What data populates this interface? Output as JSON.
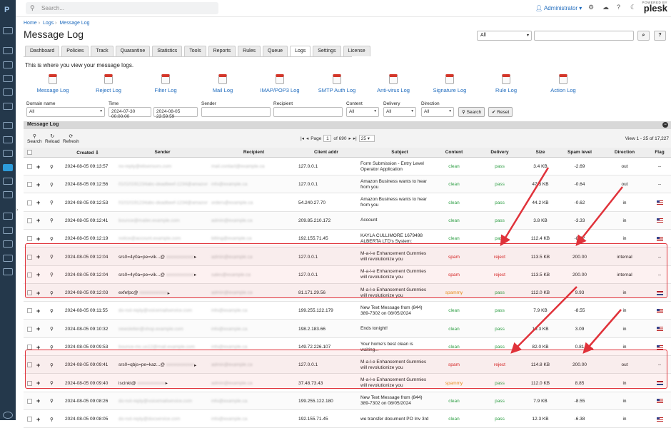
{
  "brand": {
    "logo": "P",
    "powered_by": "POWERED BY",
    "name": "plesk"
  },
  "search": {
    "placeholder": "Search..."
  },
  "user": {
    "name": "Administrator"
  },
  "breadcrumb": {
    "home": "Home",
    "logs": "Logs",
    "message_log": "Message Log"
  },
  "page": {
    "title": "Message Log",
    "intro": "This is where you view your message logs."
  },
  "top_filter": {
    "selected": "All",
    "search_btn": "⌕",
    "help_btn": "?"
  },
  "tabs": [
    "Dashboard",
    "Policies",
    "Track",
    "Quarantine",
    "Statistics",
    "Tools",
    "Reports",
    "Rules",
    "Queue",
    "Logs",
    "Settings",
    "License"
  ],
  "active_tab": "Logs",
  "log_links": [
    "Message Log",
    "Reject Log",
    "Filter Log",
    "Mail Log",
    "IMAP/POP3 Log",
    "SMTP Auth Log",
    "Anti-virus Log",
    "Signature Log",
    "Rule Log",
    "Action Log"
  ],
  "filters": {
    "domain_label": "Domain name",
    "domain_value": "All",
    "time_label": "Time",
    "time_from": "2024-07-30 00:00:00",
    "time_to": "2024-08-05 23:59:59",
    "sender_label": "Sender",
    "recipient_label": "Recipient",
    "content_label": "Content",
    "content_value": "All",
    "delivery_label": "Delivery",
    "delivery_value": "All",
    "direction_label": "Direction",
    "direction_value": "All",
    "search_btn": "Search",
    "reset_btn": "Reset"
  },
  "panel": {
    "title": "Message Log",
    "tool_search": "Search",
    "tool_reload": "Reload",
    "tool_refresh": "Refresh",
    "page_label": "Page",
    "page_value": "1",
    "page_total": "of 690",
    "per_page": "25",
    "view": "View 1 - 25 of 17,227"
  },
  "columns": [
    "Created",
    "Sender",
    "Recipient",
    "Client addr",
    "Subject",
    "Content",
    "Delivery",
    "Size",
    "Spam level",
    "Direction",
    "Flag"
  ],
  "created_sort": "⇩",
  "rows": [
    {
      "created": "2024-08-05 09:13:57",
      "sender": "no-reply@ebsensors.com",
      "recipient": "mail.contact@example.ca",
      "client": "127.0.0.1",
      "subject": "Form Submission - Entry Level Operator Application",
      "content": "clean",
      "delivery": "pass",
      "size": "3.4 KB",
      "spam": "-2.69",
      "dir": "out",
      "flag": "--"
    },
    {
      "created": "2024-08-05 09:12:56",
      "sender": "01010191234abc-deadbeef-1234@amazonses.com",
      "recipient": "info@example.ca",
      "client": "127.0.0.1",
      "subject": "Amazon Business wants to hear from you",
      "content": "clean",
      "delivery": "pass",
      "size": "47.3 KB",
      "spam": "-0.64",
      "dir": "out",
      "flag": "--"
    },
    {
      "created": "2024-08-05 09:12:53",
      "sender": "01010191234abc-deadbeef-1234@amazonses.com",
      "recipient": "orders@example.ca",
      "client": "54.240.27.70",
      "subject": "Amazon Business wants to hear from you",
      "content": "clean",
      "delivery": "pass",
      "size": "44.2 KB",
      "spam": "-0.62",
      "dir": "in",
      "flag": "us"
    },
    {
      "created": "2024-08-05 09:12:41",
      "sender": "bounce@mailer.example.com",
      "recipient": "admin@example.ca",
      "client": "209.85.210.172",
      "subject": "Account",
      "content": "clean",
      "delivery": "pass",
      "size": "3.8 KB",
      "spam": "-3.33",
      "dir": "in",
      "flag": "us"
    },
    {
      "created": "2024-08-05 09:12:19",
      "sender": "notice@account.example.com",
      "recipient": "billing@example.ca",
      "client": "192.155.71.45",
      "subject": "KAYLA CULLIMORE 1679498 ALBERTA LTD's System:",
      "content": "clean",
      "delivery": "pass",
      "size": "112.4 KB",
      "spam": "-8.22",
      "dir": "in",
      "flag": "us"
    },
    {
      "created": "2024-08-05 09:12:04",
      "sender": "srs0=4y0a=pe=vik...@",
      "recipient": "admin@example.ca",
      "client": "127.0.0.1",
      "subject": "M-a-l-e Enhancement Gummies will revolutionize you",
      "content": "spam",
      "delivery": "reject",
      "size": "113.5 KB",
      "spam": "200.00",
      "dir": "internal",
      "flag": "--"
    },
    {
      "created": "2024-08-05 09:12:04",
      "sender": "srs0=4y0a=pe=vik...@",
      "recipient": "sales@example.ca",
      "client": "127.0.0.1",
      "subject": "M-a-l-e Enhancement Gummies will revolutionize you",
      "content": "spam",
      "delivery": "reject",
      "size": "113.5 KB",
      "spam": "200.00",
      "dir": "internal",
      "flag": "--"
    },
    {
      "created": "2024-08-05 09:12:03",
      "sender": "exfefpc@",
      "recipient": "admin@example.ca",
      "client": "81.171.29.56",
      "subject": "M-a-l-e Enhancement Gummies will revolutionize you",
      "content": "spammy",
      "delivery": "pass",
      "size": "112.0 KB",
      "spam": "9.93",
      "dir": "in",
      "flag": "nl"
    },
    {
      "created": "2024-08-05 09:11:55",
      "sender": "do-not-reply@voicemailservice.com",
      "recipient": "info@example.ca",
      "client": "199.255.122.179",
      "subject": "New Text Message from (844) 389-7302 on 08/05/2024",
      "content": "clean",
      "delivery": "pass",
      "size": "7.9 KB",
      "spam": "-8.55",
      "dir": "in",
      "flag": "us"
    },
    {
      "created": "2024-08-05 09:10:32",
      "sender": "newsletter@shop.example.com",
      "recipient": "info@example.ca",
      "client": "198.2.183.66",
      "subject": "Ends tonight!",
      "content": "clean",
      "delivery": "pass",
      "size": "19.3 KB",
      "spam": "3.09",
      "dir": "in",
      "flag": "us"
    },
    {
      "created": "2024-08-05 09:09:53",
      "sender": "bounce-mc.us12@mail.example.com",
      "recipient": "info@example.ca",
      "client": "149.72.226.107",
      "subject": "Your home's best clean is waiting...",
      "content": "clean",
      "delivery": "pass",
      "size": "82.0 KB",
      "spam": "0.81",
      "dir": "in",
      "flag": "us"
    },
    {
      "created": "2024-08-05 09:09:41",
      "sender": "srs0=qbjs=pe=kaz...@",
      "recipient": "admin@example.ca",
      "client": "127.0.0.1",
      "subject": "M-a-l-e Enhancement Gummies will revolutionize you",
      "content": "spam",
      "delivery": "reject",
      "size": "114.8 KB",
      "spam": "200.00",
      "dir": "out",
      "flag": "--"
    },
    {
      "created": "2024-08-05 09:09:40",
      "sender": "iscinkt@",
      "recipient": "admin@example.ca",
      "client": "37.48.73.43",
      "subject": "M-a-l-e Enhancement Gummies will revolutionize you",
      "content": "spammy",
      "delivery": "pass",
      "size": "112.0 KB",
      "spam": "8.85",
      "dir": "in",
      "flag": "nl"
    },
    {
      "created": "2024-08-05 09:08:26",
      "sender": "do-not-reply@voicemailservice.com",
      "recipient": "info@example.ca",
      "client": "199.255.122.180",
      "subject": "New Text Message from (844) 389-7302 on 08/05/2024",
      "content": "clean",
      "delivery": "pass",
      "size": "7.9 KB",
      "spam": "-8.55",
      "dir": "in",
      "flag": "us"
    },
    {
      "created": "2024-08-05 09:08:05",
      "sender": "do-not-reply@docservice.com",
      "recipient": "info@example.ca",
      "client": "192.155.71.45",
      "subject": "we transfer document PO Inv 3rd",
      "content": "clean",
      "delivery": "pass",
      "size": "12.3 KB",
      "spam": "-6.38",
      "dir": "in",
      "flag": "us"
    }
  ]
}
